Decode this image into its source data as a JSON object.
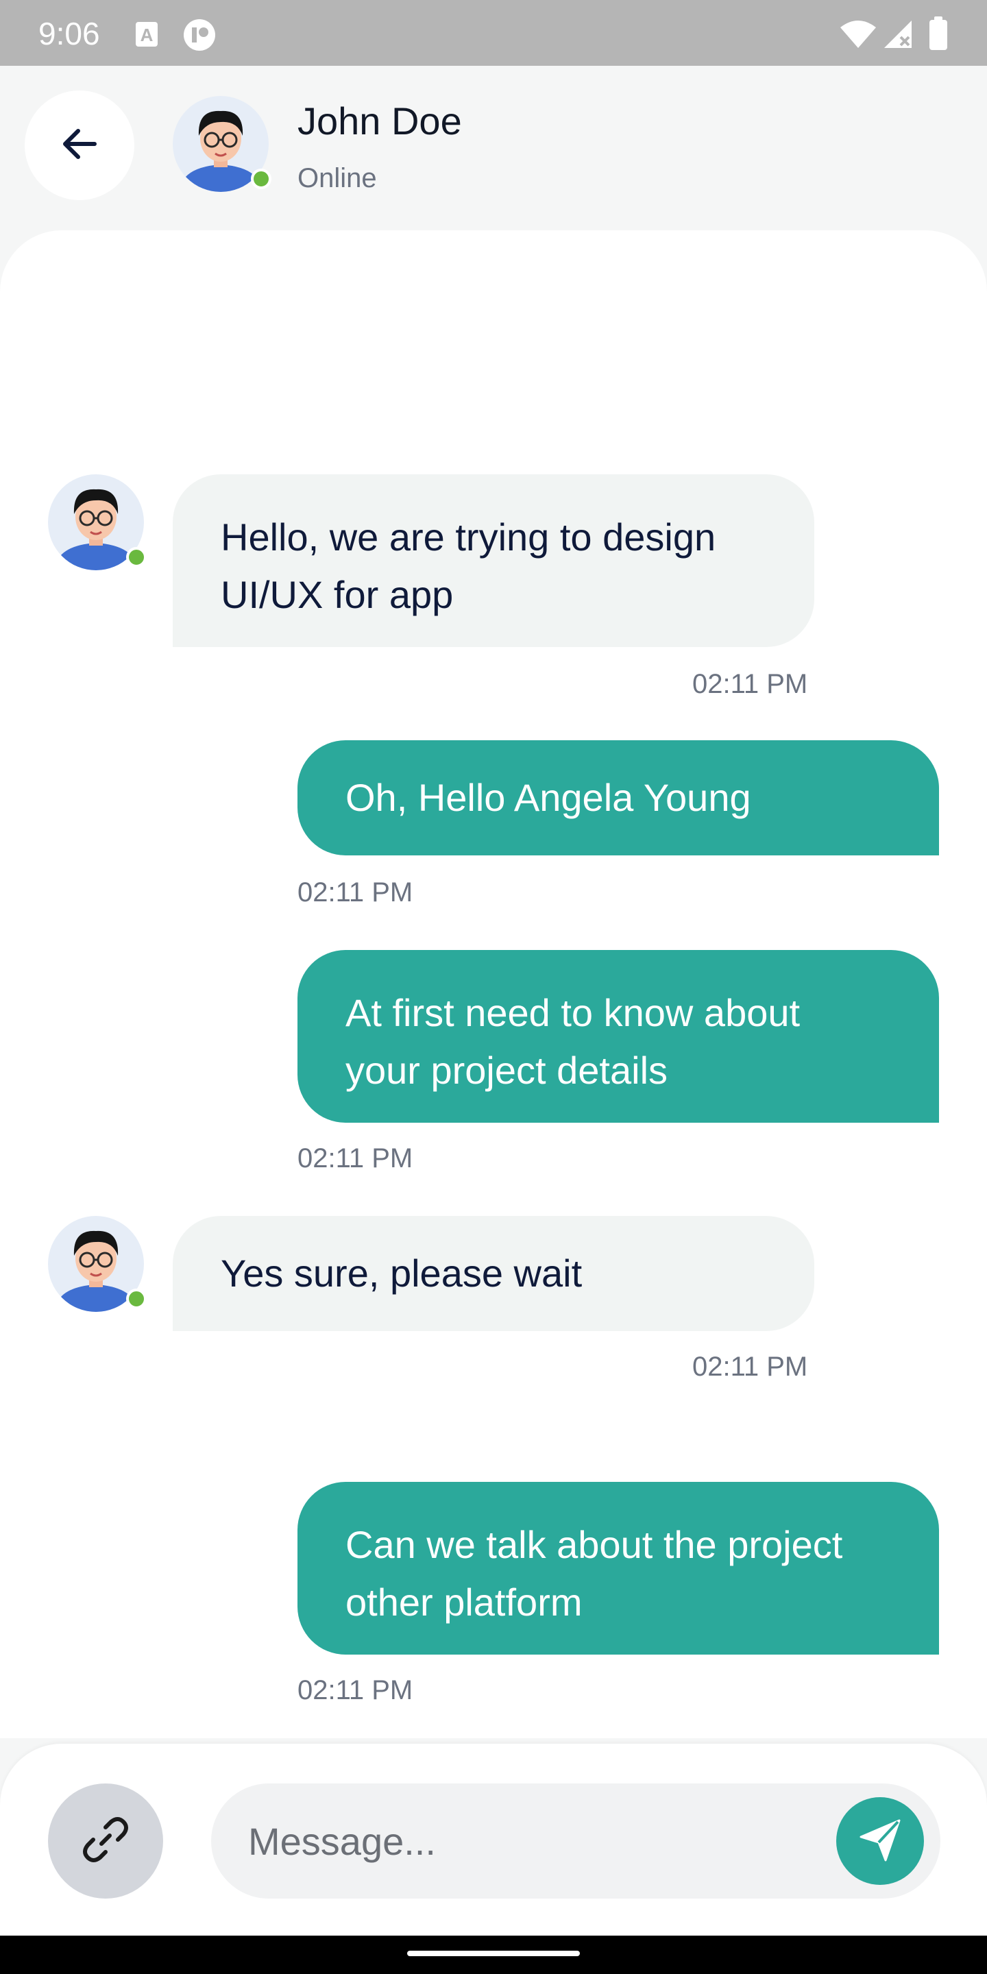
{
  "status_bar": {
    "time": "9:06",
    "icons": [
      "text-recognition-icon",
      "app-notification-icon",
      "wifi-icon",
      "signal-no-service-icon",
      "battery-icon"
    ]
  },
  "header": {
    "back_icon": "arrow-left-icon",
    "contact_name": "John Doe",
    "contact_status": "Online"
  },
  "messages": [
    {
      "direction": "incoming",
      "lines": [
        "Hello, we are trying to design",
        "UI/UX for app"
      ],
      "time": "02:11 PM"
    },
    {
      "direction": "outgoing",
      "lines": [
        "Oh, Hello Angela Young"
      ],
      "time": "02:11 PM"
    },
    {
      "direction": "outgoing",
      "lines": [
        "At first need to know about",
        "your project details"
      ],
      "time": "02:11 PM"
    },
    {
      "direction": "incoming",
      "lines": [
        "Yes sure, please wait"
      ],
      "time": "02:11 PM"
    },
    {
      "direction": "outgoing",
      "lines": [
        "Can we talk about the project",
        "other platform"
      ],
      "time": "02:11 PM"
    }
  ],
  "composer": {
    "attach_icon": "link-icon",
    "placeholder": "Message...",
    "value": "",
    "send_icon": "send-icon"
  },
  "colors": {
    "accent": "#2ba99b",
    "online": "#6ab93f",
    "incoming_bubble": "#f1f4f3",
    "text_dark": "#0f1a3a",
    "time_gray": "#6b7280"
  }
}
